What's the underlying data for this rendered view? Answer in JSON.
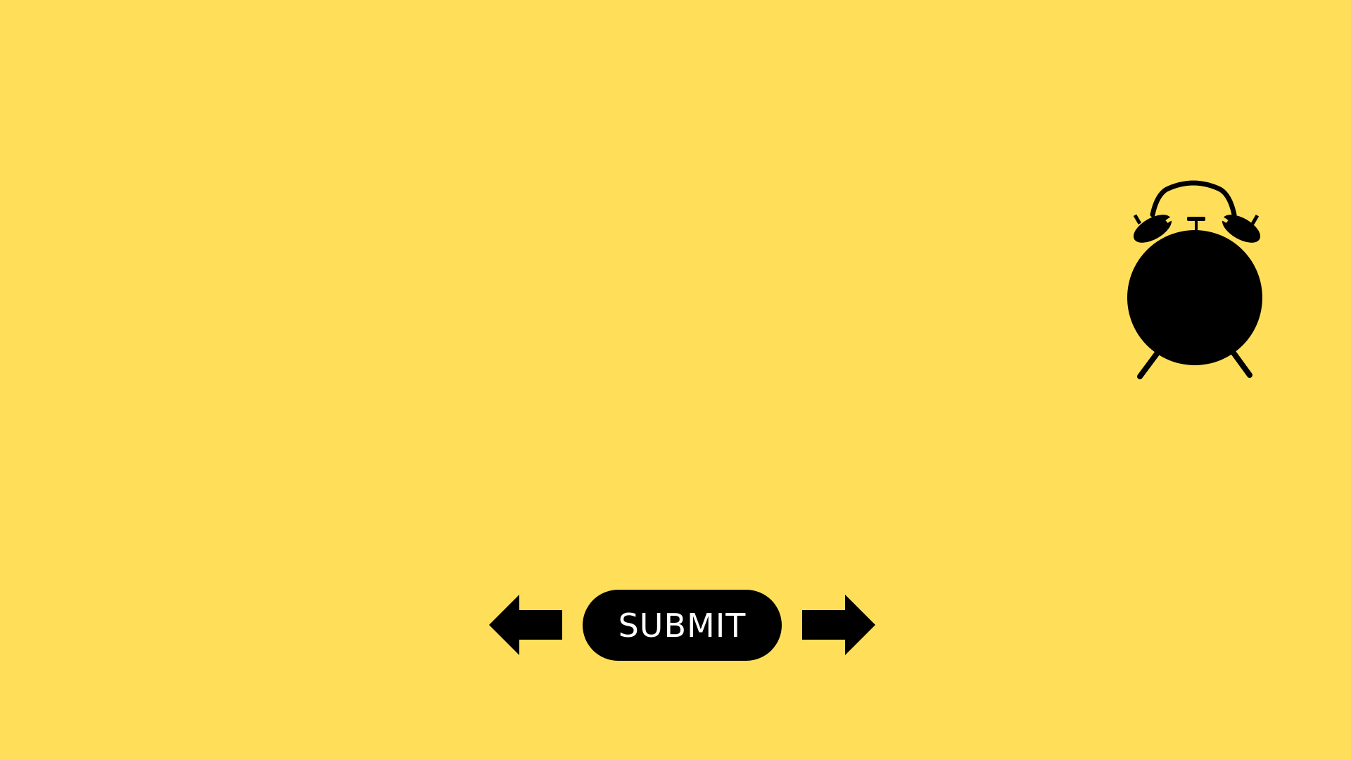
{
  "screen": {
    "background_color": "#FFDF5A",
    "foreground_color": "#000000"
  },
  "clock": {
    "icon": "alarm-clock-icon"
  },
  "navigation": {
    "previous_icon": "arrow-left-icon",
    "next_icon": "arrow-right-icon",
    "submit_label": "SUBMIT",
    "submit_text_color": "#FFFFFF"
  }
}
